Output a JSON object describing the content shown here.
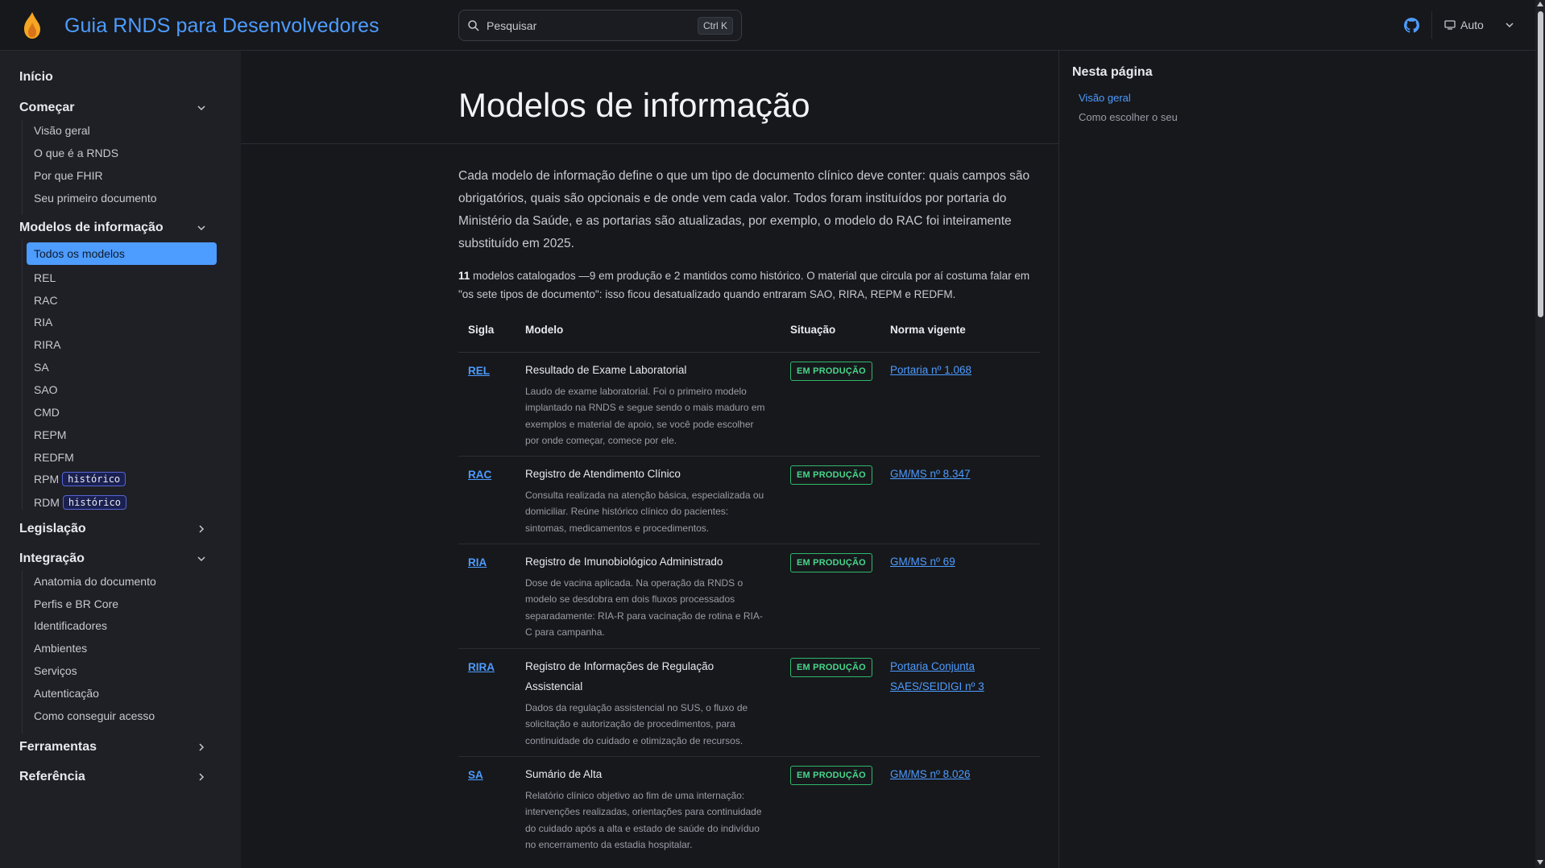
{
  "header": {
    "site_title": "Guia RNDS para Desenvolvedores",
    "search_placeholder": "Pesquisar",
    "search_shortcut": "Ctrl K",
    "theme_label": "Auto",
    "logo_icon": "flame-logo-icon",
    "github_icon": "github-icon"
  },
  "sidebar": {
    "inicio": "Início",
    "groups": {
      "comecar": {
        "title": "Começar",
        "items": [
          "Visão geral",
          "O que é a RNDS",
          "Por que FHIR",
          "Seu primeiro documento"
        ]
      },
      "modelos": {
        "title": "Modelos de informação",
        "items": [
          "Todos os modelos",
          "REL",
          "RAC",
          "RIA",
          "RIRA",
          "SA",
          "SAO",
          "CMD",
          "REPM",
          "REDFM",
          "RPM",
          "RDM"
        ],
        "historico_badge": "histórico"
      },
      "legislacao": {
        "title": "Legislação"
      },
      "integracao": {
        "title": "Integração",
        "items": [
          "Anatomia do documento",
          "Perfis e BR Core",
          "Identificadores",
          "Ambientes",
          "Serviços",
          "Autenticação",
          "Como conseguir acesso"
        ]
      },
      "ferramentas": {
        "title": "Ferramentas"
      },
      "referencia": {
        "title": "Referência"
      }
    }
  },
  "main": {
    "title": "Modelos de informação",
    "intro": "Cada modelo de informação define o que um tipo de documento clínico deve conter: quais campos são obrigatórios, quais são opcionais e de onde vem cada valor. Todos foram instituídos por portaria do Ministério da Saúde, e as portarias são atualizadas, por exemplo, o modelo do RAC foi inteiramente substituído em 2025.",
    "note_count": "11",
    "note_text": " modelos catalogados —9 em produção e 2 mantidos como histórico. O material que circula por aí costuma falar em \"os sete tipos de documento\": isso ficou desatualizado quando entraram SAO, RIRA, REPM e REDFM.",
    "table": {
      "headers": [
        "Sigla",
        "Modelo",
        "Situação",
        "Norma vigente"
      ],
      "rows": [
        {
          "sigla": "REL",
          "modelo": "Resultado de Exame Laboratorial",
          "descricao": "Laudo de exame laboratorial. Foi o primeiro modelo implantado na RNDS e segue sendo o mais maduro em exemplos e material de apoio, se você pode escolher por onde começar, comece por ele.",
          "situacao": "EM PRODUÇÃO",
          "norma": "Portaria nº 1.068"
        },
        {
          "sigla": "RAC",
          "modelo": "Registro de Atendimento Clínico",
          "descricao": "Consulta realizada na atenção básica, especializada ou domiciliar. Reúne histórico clínico do pacientes: sintomas, medicamentos e procedimentos.",
          "situacao": "EM PRODUÇÃO",
          "norma": "GM/MS nº 8.347"
        },
        {
          "sigla": "RIA",
          "modelo": "Registro de Imunobiológico Administrado",
          "descricao": "Dose de vacina aplicada. Na operação da RNDS o modelo se desdobra em dois fluxos processados separadamente: RIA-R para vacinação de rotina e RIA-C para campanha.",
          "situacao": "EM PRODUÇÃO",
          "norma": "GM/MS nº 69"
        },
        {
          "sigla": "RIRA",
          "modelo": "Registro de Informações de Regulação Assistencial",
          "descricao": "Dados da regulação assistencial no SUS, o fluxo de solicitação e autorização de procedimentos, para continuidade do cuidado e otimização de recursos.",
          "situacao": "EM PRODUÇÃO",
          "norma": "Portaria Conjunta SAES/SEIDIGI nº 3"
        },
        {
          "sigla": "SA",
          "modelo": "Sumário de Alta",
          "descricao": "Relatório clínico objetivo ao fim de uma internação: intervenções realizadas, orientações para continuidade do cuidado após a alta e estado de saúde do indivíduo no encerramento da estadia hospitalar.",
          "situacao": "EM PRODUÇÃO",
          "norma": "GM/MS nº 8.026"
        }
      ]
    }
  },
  "toc": {
    "title": "Nesta página",
    "items": [
      "Visão geral",
      "Como escolher o seu"
    ]
  },
  "colors": {
    "accent": "#4d9cff",
    "status_green": "#47d68a",
    "badge_border": "#5665d6"
  }
}
